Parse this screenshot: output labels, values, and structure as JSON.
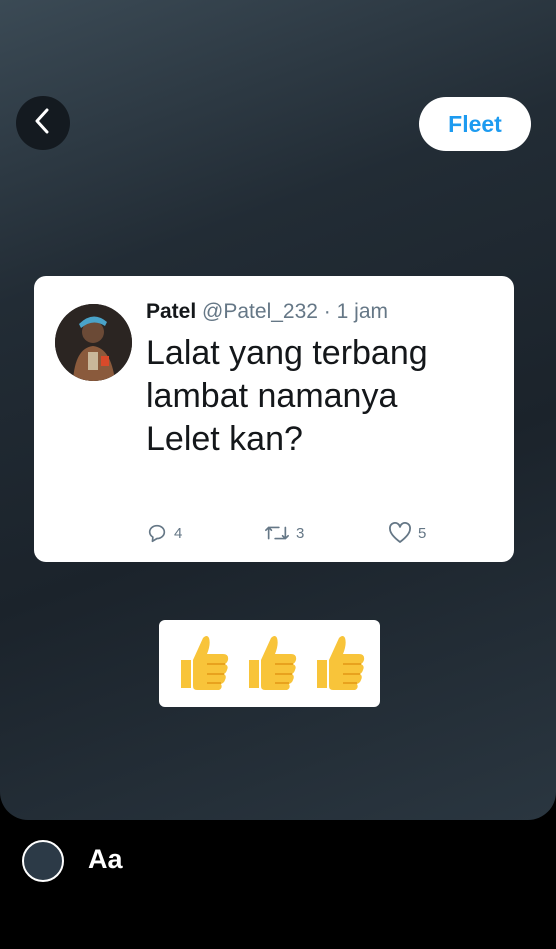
{
  "top_bar": {
    "fleet_label": "Fleet"
  },
  "tweet": {
    "name": "Patel",
    "handle": "@Patel_232",
    "separator": "·",
    "time": "1 jam",
    "text": "Lalat yang terbang lambat namanya Lelet kan?",
    "replies": "4",
    "retweets": "3",
    "likes": "5"
  },
  "sticker": {
    "emoji": [
      "👍",
      "👍",
      "👍"
    ]
  },
  "bottom_bar": {
    "text_tool_label": "Aa"
  },
  "colors": {
    "accent": "#1d9bf0",
    "thumbs": "#f8c43a"
  },
  "icons": {
    "back": "chevron-left-icon",
    "reply": "reply-icon",
    "retweet": "retweet-icon",
    "like": "heart-icon"
  }
}
